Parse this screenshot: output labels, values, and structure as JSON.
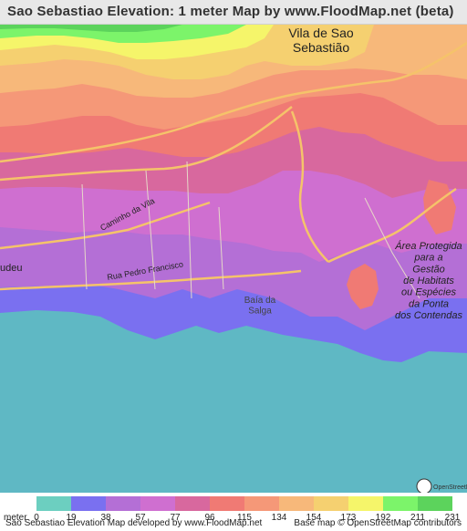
{
  "header": {
    "title": "Sao Sebastiao Elevation: 1 meter Map by www.FloodMap.net (beta)"
  },
  "map": {
    "places": {
      "vila": "Vila de Sao\nSebastião",
      "caminho": "Caminho da Vila",
      "rua": "Rua Pedro Francisco",
      "baia": "Baía da\nSalga",
      "udeu": "udeu",
      "area": "Área Protegida\npara a\nGestão\nde Habitats\nou Espécies\nda Ponta\ndos Contendas"
    },
    "colors": {
      "sea": "#5fb8c4",
      "road": "#f5c36a"
    }
  },
  "legend": {
    "unit": "meter",
    "ticks": [
      "0",
      "19",
      "38",
      "57",
      "77",
      "96",
      "115",
      "134",
      "154",
      "173",
      "192",
      "211",
      "231"
    ],
    "colors": [
      "#6ccfc0",
      "#7a70f0",
      "#b46fd6",
      "#cf6fd0",
      "#d8689e",
      "#f07a74",
      "#f59878",
      "#f7b87a",
      "#f5d070",
      "#f5f56a",
      "#7cf46a",
      "#5cd35c"
    ]
  },
  "footer": {
    "left": "Sao Sebastiao Elevation Map developed by www.FloodMap.net",
    "right": "Base map © OpenStreetMap contributors"
  }
}
